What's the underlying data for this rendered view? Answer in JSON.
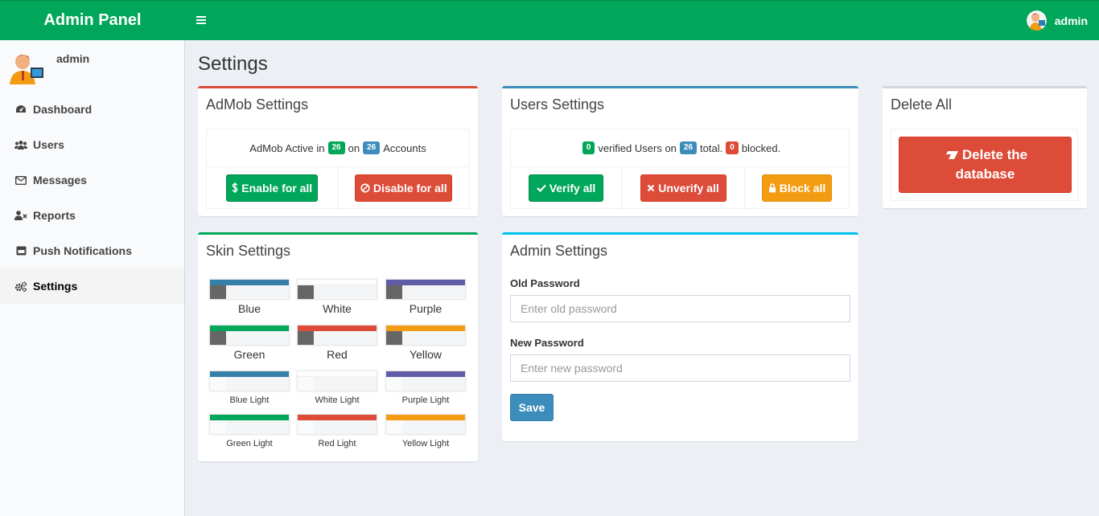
{
  "header": {
    "brand": "Admin Panel",
    "menu_icon": "hamburger-icon",
    "user_name": "admin"
  },
  "sidebar": {
    "user_name": "admin",
    "items": [
      {
        "label": "Dashboard",
        "icon": "dashboard-icon"
      },
      {
        "label": "Users",
        "icon": "users-icon"
      },
      {
        "label": "Messages",
        "icon": "envelope-icon"
      },
      {
        "label": "Reports",
        "icon": "user-times-icon"
      },
      {
        "label": "Push Notifications",
        "icon": "notification-icon"
      },
      {
        "label": "Settings",
        "icon": "cogs-icon",
        "active": true
      }
    ]
  },
  "page": {
    "title": "Settings"
  },
  "admob": {
    "title": "AdMob Settings",
    "text_before": "AdMob Active in",
    "active_count": "26",
    "text_mid": "on",
    "total_count": "26",
    "text_after": "Accounts",
    "enable_label": "Enable for all",
    "disable_label": "Disable for all"
  },
  "users_settings": {
    "title": "Users Settings",
    "verified_count": "0",
    "text_verified": "verified Users on",
    "total_count": "26",
    "text_total": "total.",
    "blocked_count": "0",
    "text_blocked": "blocked.",
    "verify_label": "Verify all",
    "unverify_label": "Unverify all",
    "block_label": "Block all"
  },
  "delete_all": {
    "title": "Delete All",
    "button_line1": "Delete the",
    "button_line2": "database"
  },
  "skins": {
    "title": "Skin Settings",
    "items": [
      {
        "label": "Blue",
        "color": "#367fa9",
        "light": false
      },
      {
        "label": "White",
        "color": "#fefefe",
        "light": false
      },
      {
        "label": "Purple",
        "color": "#605ca8",
        "light": false
      },
      {
        "label": "Green",
        "color": "#00a65a",
        "light": false
      },
      {
        "label": "Red",
        "color": "#dd4b39",
        "light": false
      },
      {
        "label": "Yellow",
        "color": "#f39c12",
        "light": false
      },
      {
        "label": "Blue Light",
        "color": "#367fa9",
        "light": true
      },
      {
        "label": "White Light",
        "color": "#fefefe",
        "light": true
      },
      {
        "label": "Purple Light",
        "color": "#605ca8",
        "light": true
      },
      {
        "label": "Green Light",
        "color": "#00a65a",
        "light": true
      },
      {
        "label": "Red Light",
        "color": "#dd4b39",
        "light": true
      },
      {
        "label": "Yellow Light",
        "color": "#f39c12",
        "light": true
      }
    ]
  },
  "admin_settings": {
    "title": "Admin Settings",
    "old_label": "Old Password",
    "old_placeholder": "Enter old password",
    "new_label": "New Password",
    "new_placeholder": "Enter new password",
    "save_label": "Save"
  },
  "colors": {
    "header_bg": "#00a65a",
    "content_bg": "#ecf0f5",
    "danger": "#dd4b39",
    "primary": "#3c8dbc",
    "warning": "#f39c12",
    "success": "#00a65a",
    "info": "#00c0ef"
  }
}
